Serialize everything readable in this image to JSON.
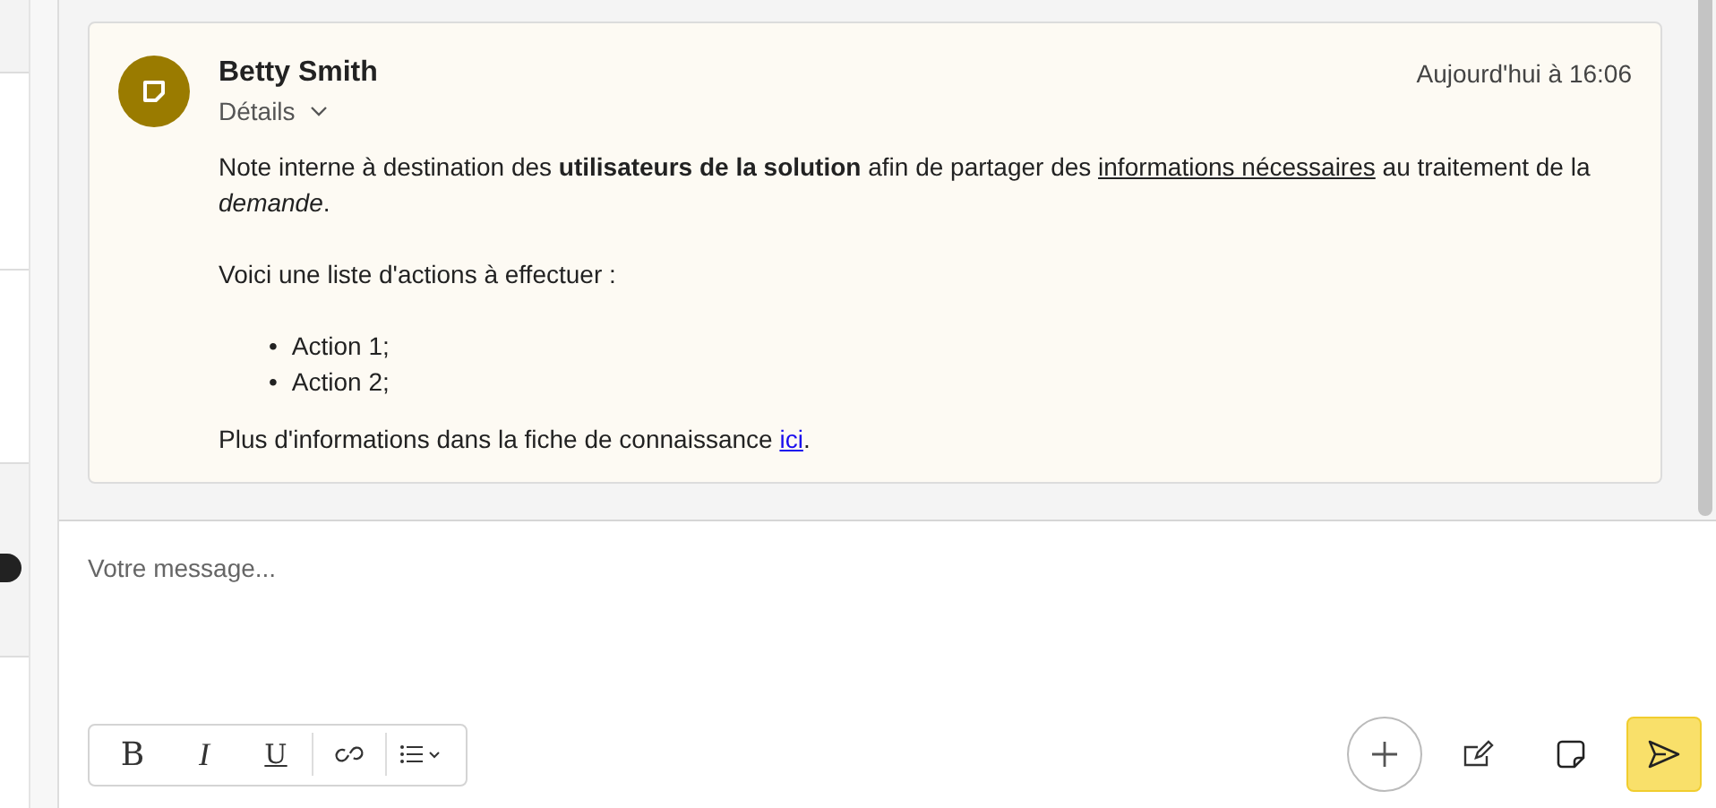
{
  "note": {
    "author": "Betty Smith",
    "details_label": "Détails",
    "timestamp": "Aujourd'hui à 16:06",
    "body": [
      {
        "kind": "paragraph",
        "segments": [
          {
            "kind": "text",
            "text": "Note interne à destination des **utilisateurs de la solution** afin de partager des "
          },
          {
            "kind": "underline",
            "text": "informations nécessaires"
          },
          {
            "kind": "text",
            "text": " au traitement de la *demande*."
          }
        ]
      },
      {
        "kind": "paragraph",
        "segments": [
          {
            "kind": "text",
            "text": "Voici une liste d'actions à effectuer :"
          }
        ]
      },
      {
        "kind": "list",
        "marker": "•",
        "items": [
          "Action 1;",
          "Action 2;"
        ]
      },
      {
        "kind": "paragraph",
        "segments": [
          {
            "kind": "text",
            "text": "Plus d'informations dans la fiche de connaissance "
          },
          {
            "kind": "link",
            "text": "ici"
          },
          {
            "kind": "text",
            "text": "."
          }
        ]
      }
    ]
  },
  "composer": {
    "placeholder": "Votre message...",
    "format_tools": [
      {
        "kind": "bold",
        "label": "B"
      },
      {
        "kind": "italic",
        "label": "I"
      },
      {
        "kind": "underline",
        "label": "U"
      },
      {
        "kind": "link"
      },
      {
        "kind": "list"
      }
    ],
    "actions": [
      {
        "kind": "add"
      },
      {
        "kind": "compose"
      },
      {
        "kind": "note"
      },
      {
        "kind": "send"
      }
    ]
  }
}
